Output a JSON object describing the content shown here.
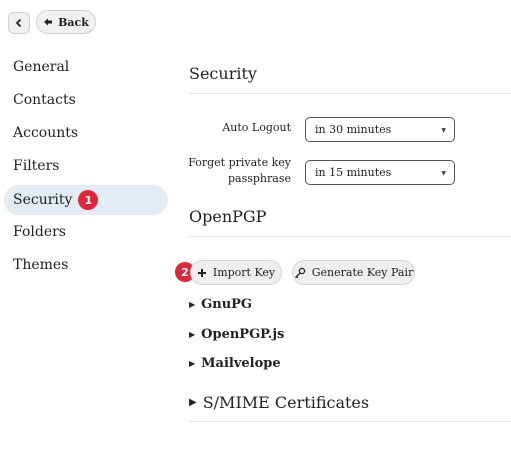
{
  "topbar": {
    "back_label": "Back"
  },
  "sidebar": {
    "items": [
      {
        "label": "General"
      },
      {
        "label": "Contacts"
      },
      {
        "label": "Accounts"
      },
      {
        "label": "Filters"
      },
      {
        "label": "Security",
        "badge": "1",
        "active": true
      },
      {
        "label": "Folders"
      },
      {
        "label": "Themes"
      }
    ]
  },
  "main": {
    "security_title": "Security",
    "auto_logout": {
      "label": "Auto Logout",
      "value": "in 30 minutes"
    },
    "forget_passphrase": {
      "label_line1": "Forget private key",
      "label_line2": "passphrase",
      "value": "in 15 minutes"
    },
    "openpgp_title": "OpenPGP",
    "import_badge": "2",
    "import_key_label": "Import Key",
    "generate_key_label": "Generate Key Pair",
    "sections": [
      "GnuPG",
      "OpenPGP.js",
      "Mailvelope"
    ],
    "smime_label": "S/MIME Certificates"
  },
  "icons": {
    "chevron": "chevron-left-icon",
    "back": "arrow-left-icon",
    "import": "plus-icon",
    "generate": "key-icon",
    "caret": "dropdown-caret-icon",
    "disclosure": "triangle-right-icon"
  },
  "colors": {
    "badge": "#e0263a",
    "active_item_bg": "#e3ebf3",
    "button_bg": "#efefef"
  }
}
